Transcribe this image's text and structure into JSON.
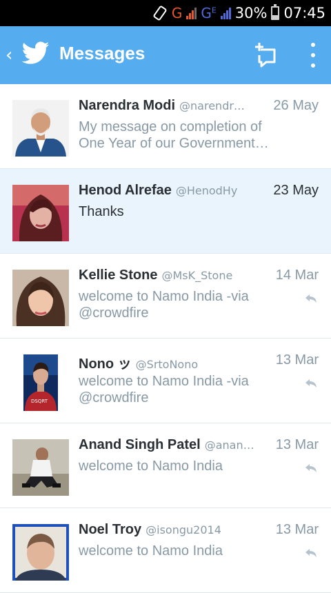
{
  "status_bar": {
    "network1": "G",
    "network2": "G",
    "network2_sup": "E",
    "battery": "30%",
    "time": "07:45"
  },
  "app_bar": {
    "back_icon": "chevron-left-icon",
    "logo_icon": "twitter-bird-icon",
    "title": "Messages",
    "compose_icon": "new-message-icon",
    "menu_icon": "more-vertical-icon"
  },
  "colors": {
    "brand": "#55acee",
    "selected_row": "#eaf4fc",
    "text_primary": "#292f33",
    "text_secondary": "#8899a6"
  },
  "messages": [
    {
      "name": "Narendra Modi",
      "handle": "@narendr…",
      "date": "26 May",
      "text": "My message on completion of One Year of our Government…",
      "selected": false,
      "reply_icon": false
    },
    {
      "name": "Henod Alrefae",
      "handle": "@HenodHy",
      "date": "23 May",
      "text": "Thanks",
      "selected": true,
      "reply_icon": false
    },
    {
      "name": "Kellie Stone",
      "handle": "@MsK_Stone",
      "date": "14 Mar",
      "text": "welcome to Namo India -via @crowdfire",
      "selected": false,
      "reply_icon": true
    },
    {
      "name": "Nono ッ",
      "handle": "@SrtoNono",
      "date": "13 Mar",
      "text": "welcome to Namo India -via @crowdfire",
      "selected": false,
      "reply_icon": true
    },
    {
      "name": "Anand Singh Patel",
      "handle": "@anan…",
      "date": "13 Mar",
      "text": "welcome to Namo India",
      "selected": false,
      "reply_icon": true
    },
    {
      "name": "Noel Troy",
      "handle": "@isongu2014",
      "date": "13 Mar",
      "text": "welcome to Namo India",
      "selected": false,
      "reply_icon": true
    }
  ]
}
